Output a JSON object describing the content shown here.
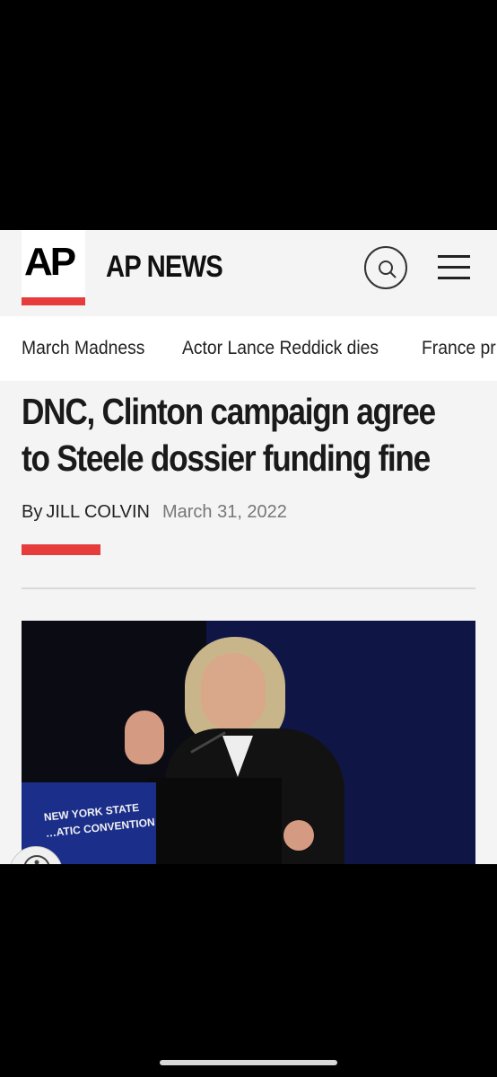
{
  "header": {
    "logo_text": "AP",
    "brand": "AP NEWS",
    "accent_color": "#e63c3c"
  },
  "topnav": {
    "items": [
      {
        "label": "March Madness"
      },
      {
        "label": "Actor Lance Reddick dies"
      },
      {
        "label": "France pr"
      }
    ]
  },
  "article": {
    "headline": "DNC, Clinton campaign agree to Steele dossier funding fine",
    "byline_prefix": "By",
    "author": "JILL COLVIN",
    "date": "March 31, 2022"
  },
  "photo": {
    "banner_line1": "NEW YORK STATE",
    "banner_line2": "…ATIC CONVENTION"
  },
  "icons": {
    "search": "search-icon",
    "menu": "hamburger-menu-icon",
    "accessibility": "accessibility-icon"
  }
}
